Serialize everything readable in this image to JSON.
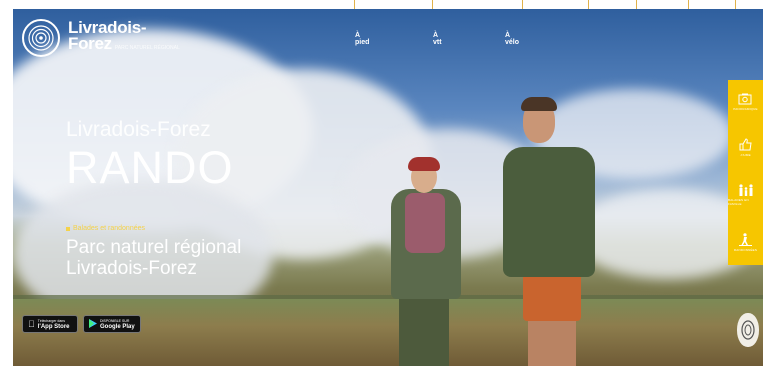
{
  "logo": {
    "line1": "Livradois-",
    "line2": "Forez",
    "sub": "PARC NATUREL RÉGIONAL"
  },
  "nav": {
    "items": [
      {
        "label": "À pied"
      },
      {
        "label": "À vtt"
      },
      {
        "label": "À vélo"
      }
    ]
  },
  "hero": {
    "subtitle": "Livradois-Forez",
    "title": "RANDO"
  },
  "tagline": "Balades et randonnées",
  "park": {
    "line1": "Parc naturel régional",
    "line2": "Livradois-Forez"
  },
  "stores": {
    "apple": {
      "small": "Télécharger dans",
      "big": "l'App Store"
    },
    "google": {
      "small": "DISPONIBLE SUR",
      "big": "Google Play"
    }
  },
  "rail": {
    "items": [
      {
        "label": "PANORAMIQUE",
        "icon": "panorama-icon"
      },
      {
        "label": "J'AIME",
        "icon": "thumbs-up-icon"
      },
      {
        "label": "BALADES EN FAMILLE",
        "icon": "family-icon"
      },
      {
        "label": "RANDONNÉES",
        "icon": "hiker-icon"
      }
    ]
  },
  "colors": {
    "accent": "#f6c600",
    "text": "#ffffff",
    "tagline": "#f4d24a"
  }
}
